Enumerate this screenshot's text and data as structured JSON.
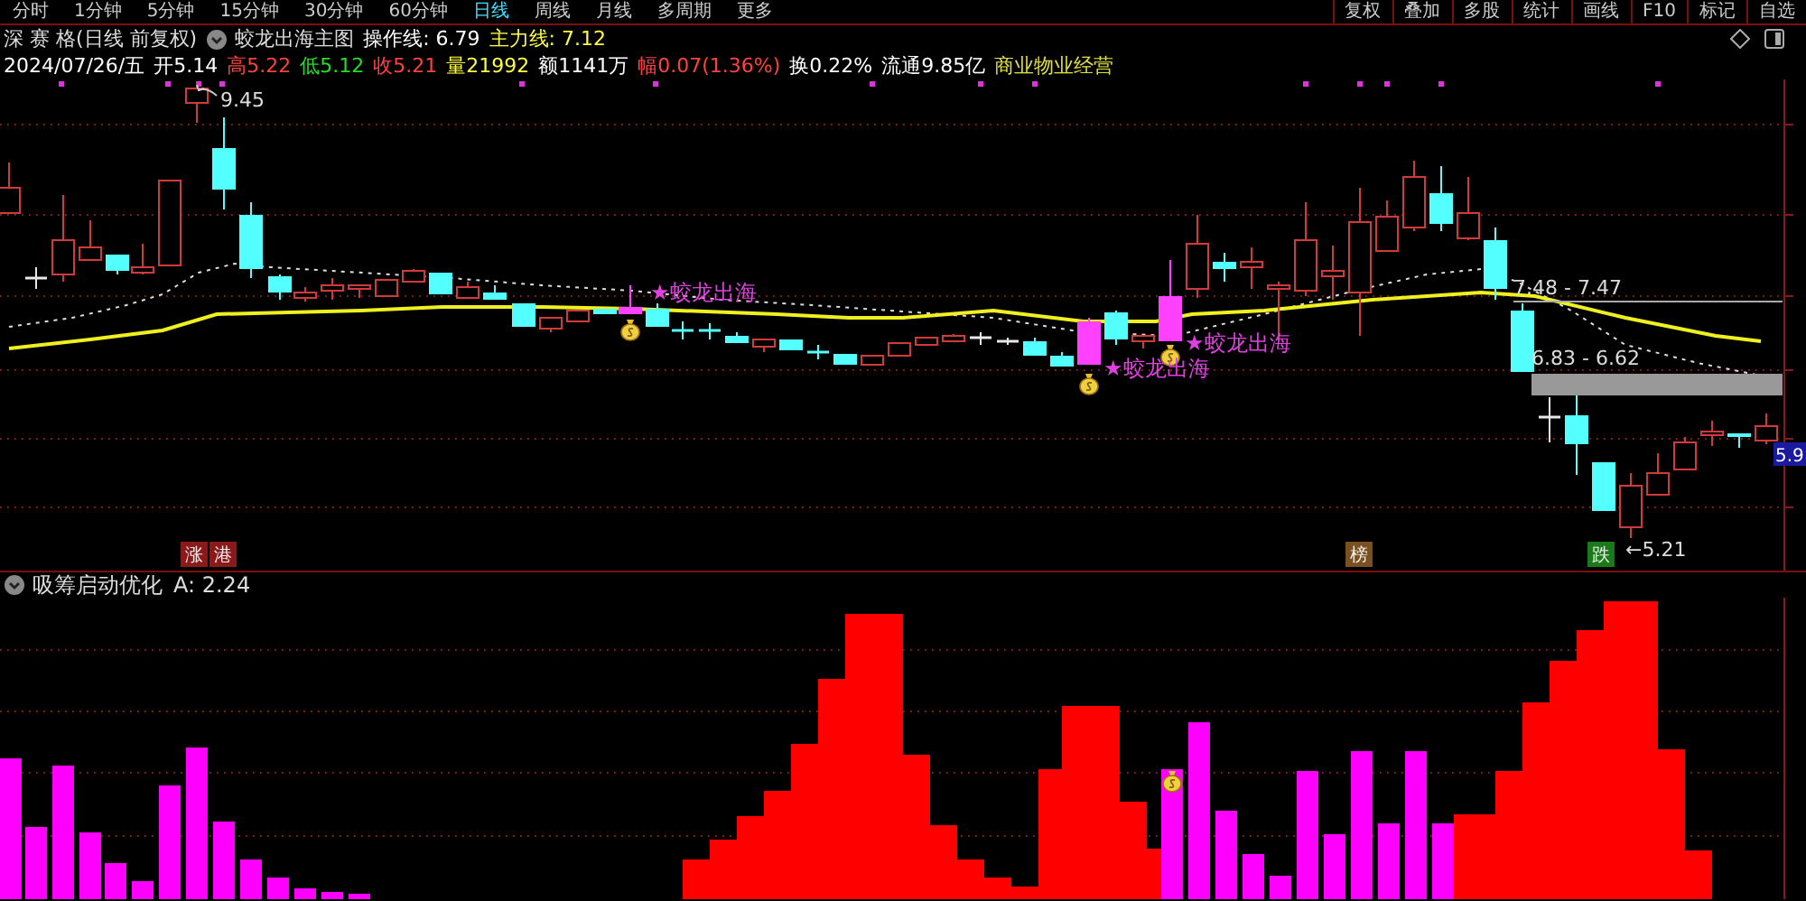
{
  "toolbar": {
    "periods": [
      {
        "label": "分时",
        "selected": false
      },
      {
        "label": "1分钟",
        "selected": false
      },
      {
        "label": "5分钟",
        "selected": false
      },
      {
        "label": "15分钟",
        "selected": false
      },
      {
        "label": "30分钟",
        "selected": false
      },
      {
        "label": "60分钟",
        "selected": false
      },
      {
        "label": "日线",
        "selected": true
      },
      {
        "label": "周线",
        "selected": false
      },
      {
        "label": "月线",
        "selected": false
      },
      {
        "label": "多周期",
        "selected": false
      },
      {
        "label": "更多",
        "selected": false
      }
    ],
    "buttons": [
      "复权",
      "叠加",
      "多股",
      "统计",
      "画线",
      "F10",
      "标记",
      "自选"
    ]
  },
  "header": {
    "stock": "深 赛 格(日线 前复权)",
    "indicator": "蛟龙出海主图",
    "lines": [
      {
        "text": "操作线: 6.79",
        "color": "#ffffff"
      },
      {
        "text": "主力线: 7.12",
        "color": "#ffff40"
      }
    ]
  },
  "quote": [
    {
      "text": "2024/07/26/五",
      "color": "#ffffff"
    },
    {
      "text": "开5.14",
      "color": "#ffffff"
    },
    {
      "text": "高5.22",
      "color": "#ff4040"
    },
    {
      "text": "低5.12",
      "color": "#20e020"
    },
    {
      "text": "收5.21",
      "color": "#ff4040"
    },
    {
      "text": "量21992",
      "color": "#ffff40"
    },
    {
      "text": "额1141万",
      "color": "#ffffff"
    },
    {
      "text": "幅0.07(1.36%)",
      "color": "#ff4040"
    },
    {
      "text": "换0.22%",
      "color": "#ffffff"
    },
    {
      "text": "流通9.85亿",
      "color": "#ffffff"
    },
    {
      "text": "商业物业经营",
      "color": "#e0e040"
    }
  ],
  "main_chart": {
    "price_labels": [
      "9.45",
      "7.48 - 7.47",
      "6.83 - 6.62",
      "←5.21"
    ],
    "signals": [
      "★蛟龙出海",
      "★蛟龙出海",
      "★蛟龙出海"
    ],
    "markers": [
      {
        "text": "涨",
        "color": "#8a1a1a"
      },
      {
        "text": "港",
        "color": "#8a1a1a"
      },
      {
        "text": "榜",
        "color": "#7a5020"
      },
      {
        "text": "跌",
        "color": "#1a7a1a"
      }
    ],
    "current_price": "5.9"
  },
  "sub_chart": {
    "title": "吸筹启动优化",
    "value": "A: 2.24"
  }
}
